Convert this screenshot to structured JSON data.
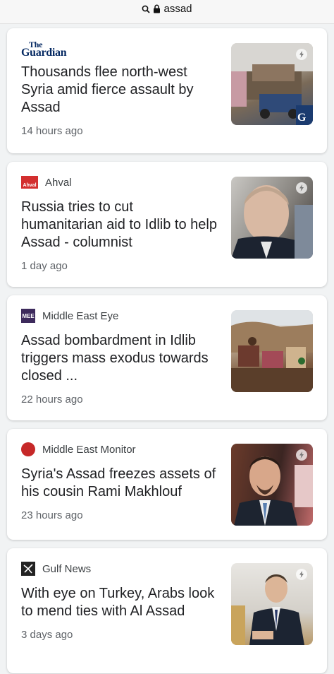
{
  "browser": {
    "url_text": "assad"
  },
  "articles": [
    {
      "source": "The Guardian",
      "logo_line1": "The",
      "logo_line2": "Guardian",
      "headline": "Thousands flee north-west Syria amid fierce assault by Assad",
      "time": "14 hours ago",
      "thumb_text": "G",
      "logo_icon": "guardian-logo"
    },
    {
      "source": "Ahval",
      "logo_text": "Ahval",
      "headline": "Russia tries to cut humanitarian aid to Idlib to help Assad - columnist",
      "time": "1 day ago",
      "logo_icon": "ahval-logo"
    },
    {
      "source": "Middle East Eye",
      "logo_text": "MEE",
      "headline": "Assad bombardment in Idlib triggers mass exodus towards closed ...",
      "time": "22 hours ago",
      "logo_icon": "middle-east-eye-logo"
    },
    {
      "source": "Middle East Monitor",
      "headline": "Syria's Assad freezes assets of his cousin Rami Makhlouf",
      "time": "23 hours ago",
      "logo_icon": "middle-east-monitor-logo"
    },
    {
      "source": "Gulf News",
      "headline": "With eye on Turkey, Arabs look to mend ties with Al Assad",
      "time": "3 days ago",
      "logo_icon": "gulf-news-logo"
    }
  ],
  "colors": {
    "background": "#f1f3f4",
    "card": "#ffffff",
    "headline": "#202124",
    "meta": "#5f6368"
  }
}
